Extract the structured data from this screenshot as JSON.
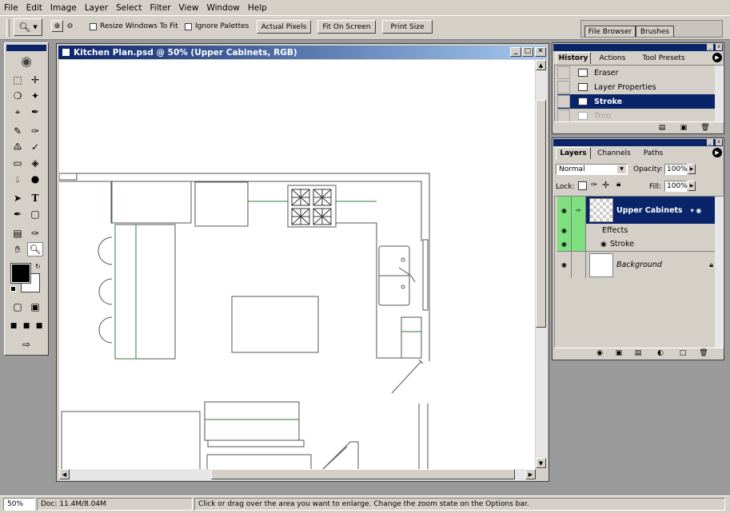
{
  "menu": [
    "File",
    "Edit",
    "Image",
    "Layer",
    "Select",
    "Filter",
    "View",
    "Window",
    "Help"
  ],
  "options": {
    "resize_windows": "Resize Windows To Fit",
    "ignore_palettes": "Ignore Palettes",
    "actual_pixels": "Actual Pixels",
    "fit_on_screen": "Fit On Screen",
    "print_size": "Print Size"
  },
  "well": {
    "tabs": [
      "File Browser",
      "Brushes"
    ]
  },
  "document": {
    "title": "Kitchen Plan.psd @ 50% (Upper Cabinets, RGB)"
  },
  "history": {
    "tabs": [
      "History",
      "Actions",
      "Tool Presets"
    ],
    "items": [
      {
        "label": "Eraser",
        "state": "normal"
      },
      {
        "label": "Layer Properties",
        "state": "normal"
      },
      {
        "label": "Stroke",
        "state": "selected"
      },
      {
        "label": "Trim",
        "state": "disabled"
      }
    ]
  },
  "layers": {
    "tabs": [
      "Layers",
      "Channels",
      "Paths"
    ],
    "blend_mode": "Normal",
    "opacity_label": "Opacity:",
    "opacity": "100%",
    "lock_label": "Lock:",
    "fill_label": "Fill:",
    "fill": "100%",
    "items": [
      {
        "name": "Upper Cabinets",
        "selected": true
      },
      {
        "name": "Effects"
      },
      {
        "name": "Stroke"
      },
      {
        "name": "Background",
        "italic": true
      }
    ]
  },
  "status": {
    "zoom": "50%",
    "doc": "Doc: 11.4M/8.04M",
    "hint": "Click or drag over the area you want to enlarge. Change the zoom state on the Options bar."
  },
  "colors": {
    "selection": "#0a246a",
    "eye_column": "#7fe07f",
    "plan_green": "#2e7d32"
  }
}
